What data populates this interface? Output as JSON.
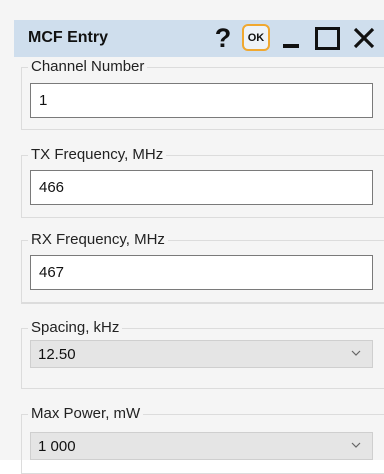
{
  "window": {
    "title": "MCF Entry",
    "help_label": "?",
    "ok_label": "OK"
  },
  "fields": {
    "channel_number": {
      "label": "Channel Number",
      "value": "1"
    },
    "tx_frequency": {
      "label": "TX Frequency, MHz",
      "value": "466"
    },
    "rx_frequency": {
      "label": "RX Frequency, MHz",
      "value": "467"
    },
    "spacing": {
      "label": "Spacing, kHz",
      "selected": "12.50"
    },
    "max_power": {
      "label": "Max Power, mW",
      "selected": "1 000"
    }
  },
  "icons": {
    "help": "question-mark-icon",
    "minimize": "minimize-icon",
    "maximize": "maximize-icon",
    "close": "close-icon",
    "dropdown": "chevron-down-icon"
  },
  "colors": {
    "titlebar": "#cfdeed",
    "ok_focus": "#f0a830",
    "background": "#f5f5f5",
    "select_bg": "#e5e5e5"
  }
}
